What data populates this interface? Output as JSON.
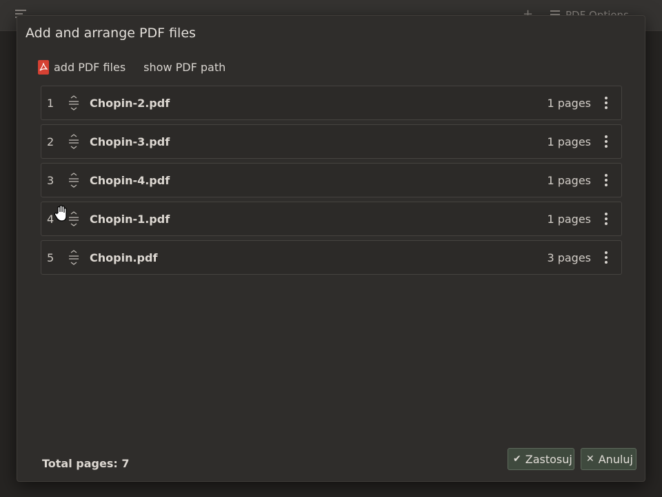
{
  "app": {
    "toolbar_plus": "+",
    "pdf_options_label": "PDF Options"
  },
  "dialog": {
    "title": "Add and arrange PDF files",
    "add_files_label": "add PDF files",
    "show_path_label": "show PDF path",
    "files": [
      {
        "index": "1",
        "name": "Chopin-2.pdf",
        "pages": "1 pages"
      },
      {
        "index": "2",
        "name": "Chopin-3.pdf",
        "pages": "1 pages"
      },
      {
        "index": "3",
        "name": "Chopin-4.pdf",
        "pages": "1 pages"
      },
      {
        "index": "4",
        "name": "Chopin-1.pdf",
        "pages": "1 pages"
      },
      {
        "index": "5",
        "name": "Chopin.pdf",
        "pages": "3 pages"
      }
    ],
    "total_pages_label": "Total pages: 7",
    "apply_label": "Zastosuj",
    "cancel_label": "Anuluj"
  },
  "icons": {
    "pdf": "pdf-file-icon",
    "drag": "drag-handle-icon",
    "menu": "more-vertical-icon",
    "apply": "check-icon",
    "cancel": "close-icon",
    "cursor": "hand-cursor-icon"
  },
  "colors": {
    "background": "#2a2826",
    "dialog_bg": "#2f2d2b",
    "pdf_red": "#d64133",
    "button_bg": "#3f4a3e"
  }
}
